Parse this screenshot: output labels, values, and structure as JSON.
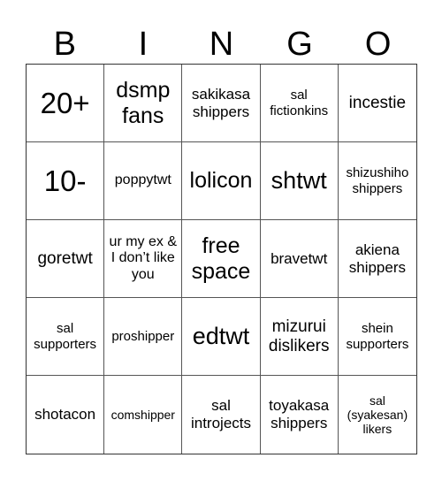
{
  "header": [
    "B",
    "I",
    "N",
    "G",
    "O"
  ],
  "cells": [
    "20+",
    "dsmp fans",
    "sakikasa shippers",
    "sal fictionkins",
    "incestie",
    "10-",
    "poppytwt",
    "lolicon",
    "shtwt",
    "shizushiho shippers",
    "goretwt",
    "ur my ex & I don’t like you",
    "free space",
    "bravetwt",
    "akiena shippers",
    "sal supporters",
    "proshipper",
    "edtwt",
    "mizurui dislikers",
    "shein supporters",
    "shotacon",
    "comshipper",
    "sal introjects",
    "toyakasa shippers",
    "sal (syakesan) likers"
  ]
}
